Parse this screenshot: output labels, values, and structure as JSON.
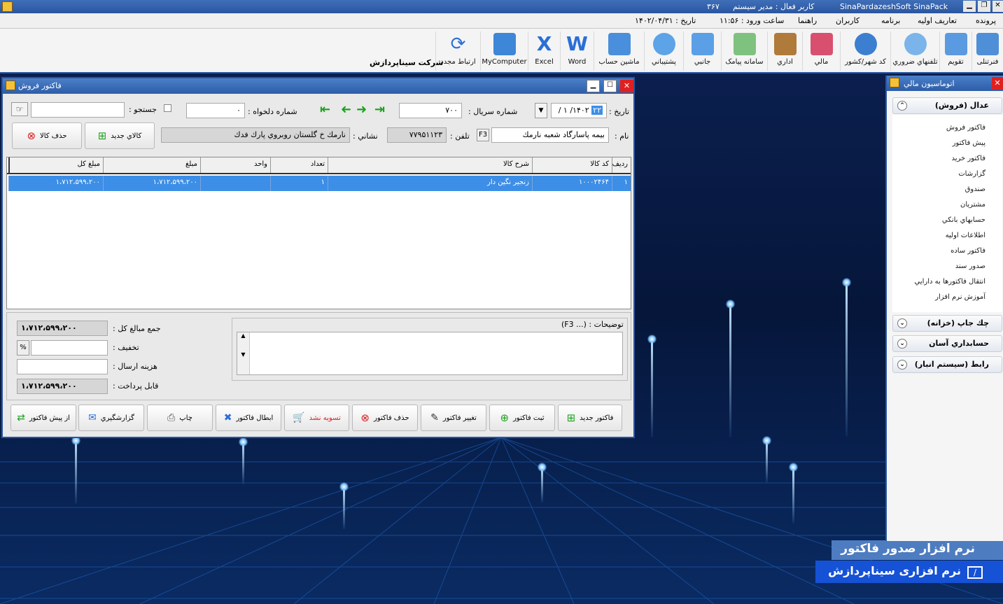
{
  "app": {
    "title": "SinaPardazeshSoft SinaPack",
    "user_label": "کاربر فعال : مدير سيستم",
    "code": "۳۶۷",
    "login_time": "ساعت ورود : ۱۱:۵۶",
    "date": "تاریخ : ۱۴۰۲/۰۴/۳۱"
  },
  "menu": [
    "پرونده",
    "تعاريف اوليه",
    "برنامه",
    "كاربران",
    "راهنما"
  ],
  "company": "شركت سيناپردازش",
  "toolbar": [
    {
      "label": "فنرتنلی",
      "icon": "person-icon"
    },
    {
      "label": "تقويم",
      "icon": "calendar-icon"
    },
    {
      "label": "تلفنهاي ضروري",
      "icon": "phone-icon"
    },
    {
      "label": "كد شهر/كشور",
      "icon": "globe-icon"
    },
    {
      "label": "مالي",
      "icon": "money-icon"
    },
    {
      "label": "اداري",
      "icon": "building-icon"
    },
    {
      "label": "سامانه پیامک",
      "icon": "sms-icon"
    },
    {
      "label": "جانبي",
      "icon": "box-icon"
    },
    {
      "label": "پشتيباني",
      "icon": "headset-icon"
    },
    {
      "label": "ماشين حساب",
      "icon": "calculator-icon"
    },
    {
      "label": "Word",
      "icon": "word-icon"
    },
    {
      "label": "Excel",
      "icon": "excel-icon"
    },
    {
      "label": "MyComputer",
      "icon": "computer-icon"
    },
    {
      "label": "ارتباط مجدد",
      "icon": "reconnect-icon"
    }
  ],
  "invoice": {
    "title": "فاكتور فروش",
    "date_label": "تاریخ :",
    "date_value": "۱۴۰۲/ ۱ /",
    "date_day": "۲۲",
    "serial_label": "شماره سريال :",
    "serial_value": "۷۰۰",
    "desired_label": "شماره دلخواه :",
    "desired_value": "۰",
    "search_label": "جستجو :",
    "name_label": "نام :",
    "name_value": "بيمه پاسارگاد شعبه نارمك",
    "f3": "F3",
    "phone_label": "تلفن :",
    "phone_value": "۷۷۹۵۱۱۲۳",
    "address_label": "نشاني :",
    "address_value": "نارمك خ گلستان روبروي پارك فدك",
    "new_item": "كالاي جديد",
    "delete_item": "حذف كالا",
    "columns": [
      "رديف",
      "كد كالا",
      "شرح كالا",
      "تعداد",
      "واحد",
      "مبلغ",
      "مبلغ كل"
    ],
    "rows": [
      {
        "row": "۱",
        "code": "۱۰۰۰۲۴۶۴",
        "desc": "زنجير نگين دار",
        "qty": "۱",
        "unit": "",
        "price": "۱،۷۱۲،۵۹۹،۲۰۰",
        "total": "۱،۷۱۲،۵۹۹،۲۰۰"
      }
    ],
    "sum_label": "جمع مبالغ كل :",
    "sum_value": "۱،۷۱۲،۵۹۹،۲۰۰",
    "discount_label": "تخفيف :",
    "percent": "%",
    "shipping_label": "هزينه ارسال :",
    "payable_label": "قابل پرداخت :",
    "payable_value": "۱،۷۱۲،۵۹۹،۲۰۰",
    "notes_label": "توضيحات : (... F3)",
    "buttons": [
      "فاكتور جديد",
      "ثبت فاكتور",
      "تغيير فاكتور",
      "حذف فاكتور",
      "تسويه نشد",
      "ابطال فاكتور",
      "چاپ",
      "گزارشگيري",
      "از پيش فاكتور"
    ]
  },
  "side": {
    "title": "اتوماسيون مالي",
    "sections": [
      "عدال (فروش)",
      "چك جاپ (خزانه)",
      "حسابداري آسان",
      "رابط (سيستم انبار)"
    ],
    "links": [
      "فاكتور فروش",
      "پيش فاكتور",
      "فاكتور خريد",
      "گزارشات",
      "صندوق",
      "مشتريان",
      "حسابهاي بانكي",
      "اطلاعات اوليه",
      "فاكتور ساده",
      "صدور سند",
      "انتقال فاكتورها به دارايي",
      "آموزش نرم افزار"
    ]
  },
  "banner": {
    "line1": "نرم افزار صدور فاکتور",
    "line2": "نرم افزاری سیناپردازش"
  },
  "colors": {
    "accent": "#2a56a0",
    "selection": "#3d8ee6",
    "danger": "#e02020"
  }
}
